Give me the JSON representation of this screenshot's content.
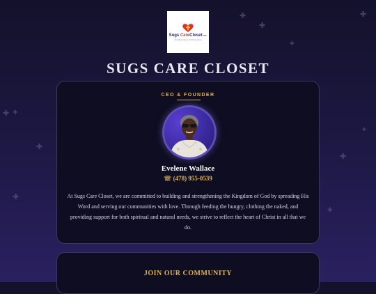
{
  "brand": {
    "logo_name": "Sugs",
    "logo_care": "Care",
    "logo_closet": "Closet",
    "logo_inc": "Inc.",
    "logo_tagline": "Feeding Hope, Clothing Love",
    "site_title": "SUGS CARE CLOSET"
  },
  "profile": {
    "role": "CEO & FOUNDER",
    "name": "Evelene Wallace",
    "phone": "☏ (478) 955-0539",
    "bio": "At Sugs Care Closet, we are committed to building and strengthening the Kingdom of God by spreading His Word and serving our communities with love. Through feeding the hungry, clothing the naked, and providing support for both spiritual and natural needs, we strive to reflect the heart of Christ in all that we do."
  },
  "community": {
    "title": "JOIN OUR COMMUNITY"
  },
  "colors": {
    "accent": "#e0b44a",
    "background_top": "#14112b",
    "background_bottom": "#2a2060",
    "card": "#0f0d22"
  }
}
